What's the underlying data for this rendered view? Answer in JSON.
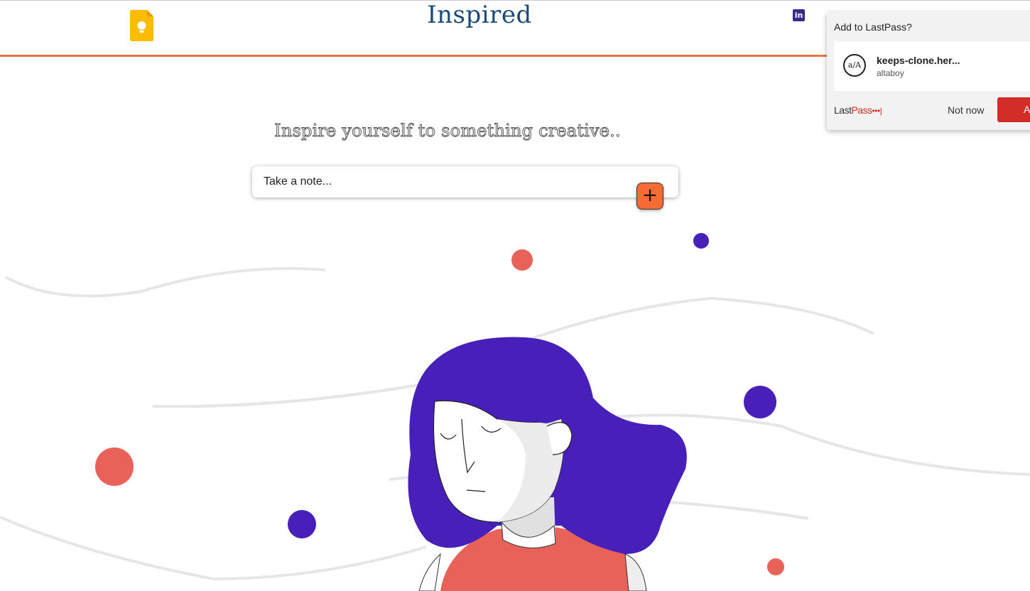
{
  "header": {
    "brand": "Inspired",
    "logo_icon": "google-keep-icon",
    "social_icon": "linkedin-icon",
    "social_text": "in",
    "accent_color": "#e07a4c"
  },
  "main": {
    "tagline": "Inspire yourself to something creative..",
    "note_placeholder": "Take a note...",
    "add_button_label": "+",
    "add_button_color": "#f46b34"
  },
  "illustration": {
    "hair_color": "#4620b8",
    "accent_color": "#e9625a"
  },
  "lastpass": {
    "title": "Add to LastPass?",
    "site": "keeps-clone.her...",
    "username": "altaboy",
    "avatar_text": "a/A",
    "logo_last": "Last",
    "logo_pass": "Pass",
    "logo_dots": "•••|",
    "not_now": "Not now",
    "add_label": "Add",
    "brand_color": "#d32d27"
  }
}
